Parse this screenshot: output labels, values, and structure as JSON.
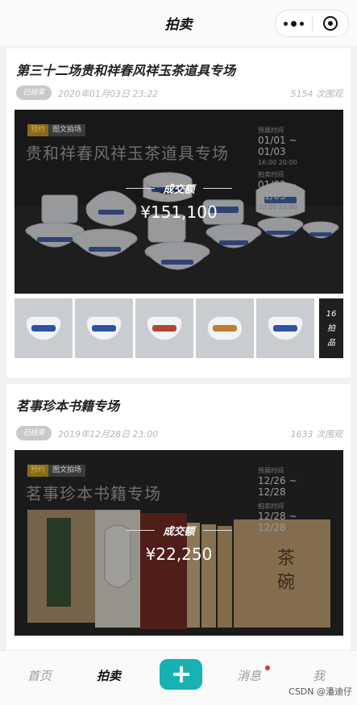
{
  "header": {
    "title": "拍卖"
  },
  "auctions": [
    {
      "title": "第三十二场贵和祥春风祥玉茶道具专场",
      "status": "已结束",
      "date": "2020年01月03日 23:22",
      "views": "5154 次围观",
      "tag_hot": "预约",
      "tag_kind": "图文拍场",
      "cover_title": "贵和祥春风祥玉茶道具专场",
      "schedule": {
        "start_label": "预展时间",
        "start_dates": "01/01 ~ 01/03",
        "start_times": "16:00      20:00",
        "end_label": "拍卖时间",
        "end_dates": "01/03 ~ 01/03",
        "end_times": "20:00      21:00"
      },
      "deal_label": "成交额",
      "deal_amount": "¥151,100",
      "lot_count": "16",
      "lot_unit_1": "拍",
      "lot_unit_2": "品"
    },
    {
      "title": "茗事珍本书籍专场",
      "status": "已结束",
      "date": "2019年12月28日 23:00",
      "views": "1633 次围观",
      "tag_hot": "预约",
      "tag_kind": "图文拍场",
      "cover_title": "茗事珍本书籍专场",
      "schedule": {
        "start_label": "预展时间",
        "start_dates": "12/26 ~ 12/28",
        "start_times": "",
        "end_label": "拍卖时间",
        "end_dates": "12/28 ~ 12/28",
        "end_times": ""
      },
      "deal_label": "成交额",
      "deal_amount": "¥22,250",
      "book_text": "茶碗"
    }
  ],
  "tabbar": {
    "home": "首页",
    "auction": "拍卖",
    "messages": "消息",
    "me": "我"
  },
  "watermark": "CSDN @潘迪仔",
  "colors": {
    "accent": "#17b1b2",
    "dark_panel": "#262626",
    "badge_dot": "#e0312a"
  }
}
